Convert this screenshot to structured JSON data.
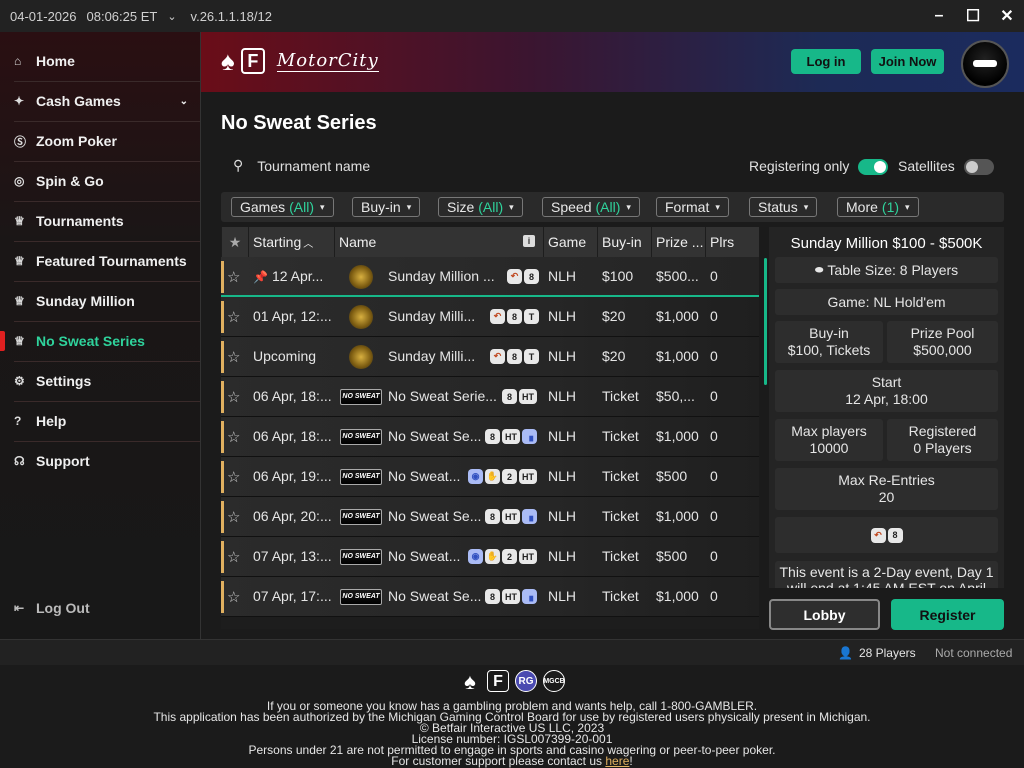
{
  "titlebar": {
    "date": "04-01-2026",
    "time": "08:06:25 ET",
    "caret": "⌄",
    "version": "v.26.1.1.18/12"
  },
  "sidebar": {
    "items": [
      {
        "label": "Home",
        "icon": "⌂"
      },
      {
        "label": "Cash Games",
        "icon": "✦",
        "chevron": "⌄"
      },
      {
        "label": "Zoom Poker",
        "icon": "Ⓢ"
      },
      {
        "label": "Spin & Go",
        "icon": "◎"
      },
      {
        "label": "Tournaments",
        "icon": "♕"
      },
      {
        "label": "Featured Tournaments",
        "icon": "♕"
      },
      {
        "label": "Sunday Million",
        "icon": "♕"
      },
      {
        "label": "No Sweat Series",
        "icon": "♕"
      },
      {
        "label": "Settings",
        "icon": "⚙"
      },
      {
        "label": "Help",
        "icon": "?"
      },
      {
        "label": "Support",
        "icon": "☊"
      }
    ],
    "logout": "Log Out"
  },
  "header": {
    "brand": "MotorCity",
    "login": "Log in",
    "join": "Join Now"
  },
  "page": {
    "title": "No Sweat Series"
  },
  "search": {
    "placeholder": "Tournament name"
  },
  "toggles": {
    "registering_only": "Registering only",
    "satellites": "Satellites"
  },
  "filters": [
    {
      "label": "Games",
      "value": "(All)"
    },
    {
      "label": "Buy-in",
      "value": ""
    },
    {
      "label": "Size",
      "value": "(All)"
    },
    {
      "label": "Speed",
      "value": "(All)"
    },
    {
      "label": "Format",
      "value": ""
    },
    {
      "label": "Status",
      "value": ""
    },
    {
      "label": "More",
      "value": "(1)"
    }
  ],
  "table": {
    "headers": {
      "starting": "Starting",
      "name": "Name",
      "game": "Game",
      "buyin": "Buy-in",
      "prize": "Prize ...",
      "plrs": "Plrs"
    },
    "rows": [
      {
        "start": "12 Apr...",
        "pinned": true,
        "logo": "sunday",
        "name": "Sunday Million ...",
        "badges": [
          "↶",
          "8"
        ],
        "game": "NLH",
        "buyin": "$100",
        "prize": "$500...",
        "plrs": "0"
      },
      {
        "start": "01 Apr, 12:...",
        "logo": "sunday",
        "name": "Sunday Milli...",
        "badges": [
          "↶",
          "8",
          "T"
        ],
        "game": "NLH",
        "buyin": "$20",
        "prize": "$1,000",
        "plrs": "0"
      },
      {
        "start": "Upcoming",
        "logo": "sunday",
        "name": "Sunday Milli...",
        "badges": [
          "↶",
          "8",
          "T"
        ],
        "game": "NLH",
        "buyin": "$20",
        "prize": "$1,000",
        "plrs": "0"
      },
      {
        "start": "06 Apr, 18:...",
        "logo": "nosweat",
        "name": "No Sweat Serie...",
        "badges": [
          "8",
          "HT"
        ],
        "game": "NLH",
        "buyin": "Ticket",
        "prize": "$50,...",
        "plrs": "0"
      },
      {
        "start": "06 Apr, 18:...",
        "logo": "nosweat",
        "name": "No Sweat Se...",
        "badges": [
          "8",
          "HT",
          "▗"
        ],
        "game": "NLH",
        "buyin": "Ticket",
        "prize": "$1,000",
        "plrs": "0"
      },
      {
        "start": "06 Apr, 19:...",
        "logo": "nosweat",
        "name": "No Sweat...",
        "badges": [
          "◉",
          "✋",
          "2",
          "HT"
        ],
        "game": "NLH",
        "buyin": "Ticket",
        "prize": "$500",
        "plrs": "0"
      },
      {
        "start": "06 Apr, 20:...",
        "logo": "nosweat",
        "name": "No Sweat Se...",
        "badges": [
          "8",
          "HT",
          "▗"
        ],
        "game": "NLH",
        "buyin": "Ticket",
        "prize": "$1,000",
        "plrs": "0"
      },
      {
        "start": "07 Apr, 13:...",
        "logo": "nosweat",
        "name": "No Sweat...",
        "badges": [
          "◉",
          "✋",
          "2",
          "HT"
        ],
        "game": "NLH",
        "buyin": "Ticket",
        "prize": "$500",
        "plrs": "0"
      },
      {
        "start": "07 Apr, 17:...",
        "logo": "nosweat",
        "name": "No Sweat Se...",
        "badges": [
          "8",
          "HT",
          "▗"
        ],
        "game": "NLH",
        "buyin": "Ticket",
        "prize": "$1,000",
        "plrs": "0"
      }
    ]
  },
  "details": {
    "title": "Sunday Million $100 - $500K",
    "table_size": "Table Size: 8 Players",
    "game": "Game: NL Hold'em",
    "buyin_label": "Buy-in",
    "buyin_value": "$100, Tickets",
    "prize_label": "Prize Pool",
    "prize_value": "$500,000",
    "start_label": "Start",
    "start_value": "12 Apr, 18:00",
    "max_label": "Max players",
    "max_value": "10000",
    "reg_label": "Registered",
    "reg_value": "0 Players",
    "reentries_label": "Max Re-Entries",
    "reentries_value": "20",
    "note": "This event is a 2-Day event, Day 1 will end at 1:45 AM EST on April"
  },
  "buttons": {
    "lobby": "Lobby",
    "register": "Register"
  },
  "status": {
    "players": "28 Players",
    "connection": "Not connected"
  },
  "footer": {
    "line1": "If you or someone you know has a gambling problem and wants help, call 1-800-GAMBLER.",
    "line2": "This application has been authorized by the Michigan Gaming Control Board for use by registered users physically present in Michigan.",
    "line3": "© Betfair Interactive US LLC, 2023",
    "line4": "License number: IGSL007399-20-001",
    "line5": "Persons under 21 are not permitted to engage in sports and casino wagering or peer-to-peer poker.",
    "line6_prefix": "For customer support please contact us ",
    "line6_link": "here",
    "line6_suffix": "!"
  }
}
